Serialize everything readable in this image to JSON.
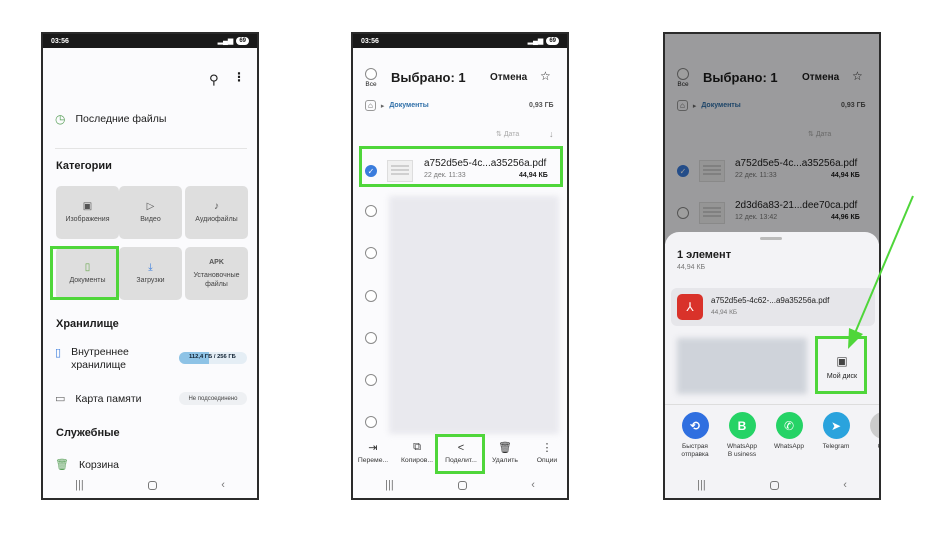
{
  "colors": {
    "highlight": "#4fd63a",
    "arrow": "#4fd63a",
    "select_blue": "#3b7ddd",
    "storage_bar": "#8ec3e6"
  },
  "status": {
    "time": "03:56",
    "battery": "69"
  },
  "screen1": {
    "recent_label": "Последние файлы",
    "categories_title": "Категории",
    "tiles": [
      {
        "label": "Изображения",
        "icon": "image-icon"
      },
      {
        "label": "Видео",
        "icon": "video-icon"
      },
      {
        "label": "Аудиофайлы",
        "icon": "music-icon"
      },
      {
        "label": "Документы",
        "icon": "document-icon"
      },
      {
        "label": "Загрузки",
        "icon": "download-icon"
      },
      {
        "label": "Установочные файлы",
        "icon": "apk-icon",
        "badge": "APK"
      }
    ],
    "storage_title": "Хранилище",
    "internal_label": "Внутреннее хранилище",
    "internal_usage": "112,4 ГБ / 256 ГБ",
    "internal_fraction": 0.44,
    "sdcard_label": "Карта памяти",
    "sdcard_status": "Не подсоединено",
    "utilities_title": "Служебные",
    "trash_label": "Корзина"
  },
  "screen2": {
    "all_label": "Все",
    "selected_title": "Выбрано: 1",
    "cancel_label": "Отмена",
    "breadcrumb": "Документы",
    "folder_size": "0,93 ГБ",
    "sort_label": "Дата",
    "file": {
      "name": "a752d5e5-4c...a35256a.pdf",
      "date": "22 дек. 11:33",
      "size": "44,94 КБ"
    },
    "actions": [
      "Переме...",
      "Копиров...",
      "Поделит...",
      "Удалить",
      "Опции"
    ]
  },
  "screen3": {
    "all_label": "Все",
    "selected_title": "Выбрано: 1",
    "cancel_label": "Отмена",
    "breadcrumb": "Документы",
    "folder_size": "0,93 ГБ",
    "sort_label": "Дата",
    "files": [
      {
        "name": "a752d5e5-4c...a35256a.pdf",
        "date": "22 дек. 11:33",
        "size": "44,94 КБ"
      },
      {
        "name": "2d3d6a83-21...dee70ca.pdf",
        "date": "12 дек. 13:42",
        "size": "44,96 КБ"
      }
    ],
    "sheet_title": "1 элемент",
    "sheet_size": "44,94 КБ",
    "share_file": {
      "name": "a752d5e5-4c62-...a9a35256a.pdf",
      "size": "44,94 КБ"
    },
    "drive_label": "Мой диск",
    "apps": [
      {
        "label": "Быстрая отправка",
        "color": "#2f6fe0"
      },
      {
        "label": "WhatsApp B usiness",
        "color": "#25d366"
      },
      {
        "label": "WhatsApp",
        "color": "#25d366"
      },
      {
        "label": "Telegram",
        "color": "#2aa3dd"
      },
      {
        "label": "C P",
        "color": "#cccccc"
      }
    ]
  }
}
